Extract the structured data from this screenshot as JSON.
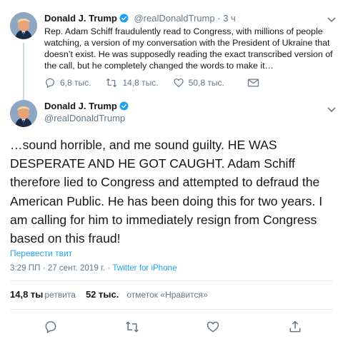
{
  "colors": {
    "accent": "#1da1f2",
    "muted": "#657786",
    "text": "#14171a",
    "divider": "#e6ecf0"
  },
  "parent_tweet": {
    "name": "Donald J. Trump",
    "handle": "@realDonaldTrump",
    "time": "· 3 ч",
    "text": "Rep. Adam Schiff fraudulently read to Congress, with millions of people watching, a version of my conversation with the President of Ukraine that doesn’t exist. He was supposedly reading the exact transcribed version of the call, but he completely changed the words to make it…",
    "replies": "6,8 тыс.",
    "retweets": "14,8 тыс.",
    "likes": "50,8 тыс."
  },
  "main_tweet": {
    "name": "Donald J. Trump",
    "handle": "@realDonaldTrump",
    "text": "…sound horrible, and me sound guilty. HE WAS DESPERATE AND HE GOT CAUGHT. Adam Schiff therefore lied to Congress and attempted to defraud the American Public. He has been doing this for two years. I am calling for him to immediately resign from Congress based on this fraud!",
    "translate": "Перевести твит",
    "timestamp": "3:29 ПП · 27 сент. 2019 г. ·",
    "source": "Twitter for iPhone",
    "retweet_count": "14,8 ты",
    "retweet_label": "ретвита",
    "like_count": "52 тыс.",
    "like_label": "отметок «Нравится»"
  }
}
